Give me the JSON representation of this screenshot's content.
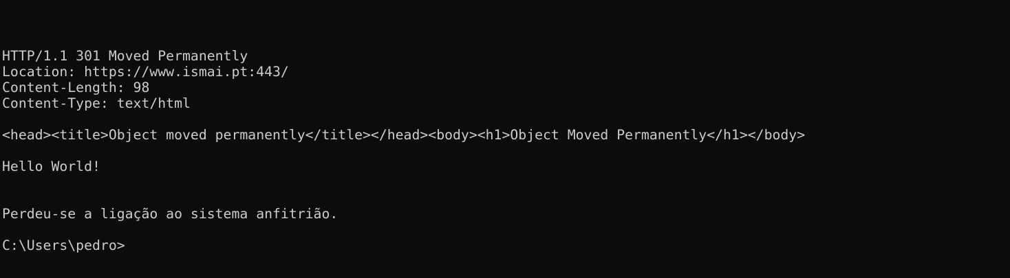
{
  "terminal": {
    "colors": {
      "background": "#0c0c0c",
      "foreground": "#cccccc"
    },
    "lines": {
      "status": "HTTP/1.1 301 Moved Permanently",
      "location": "Location: https://www.ismai.pt:443/",
      "content_length": "Content-Length: 98",
      "content_type": "Content-Type: text/html",
      "body_html": "<head><title>Object moved permanently</title></head><body><h1>Object Moved Permanently</h1></body>",
      "hello": "Hello World!",
      "connection_lost": "Perdeu-se a ligação ao sistema anfitrião.",
      "prompt": "C:\\Users\\pedro>"
    }
  }
}
